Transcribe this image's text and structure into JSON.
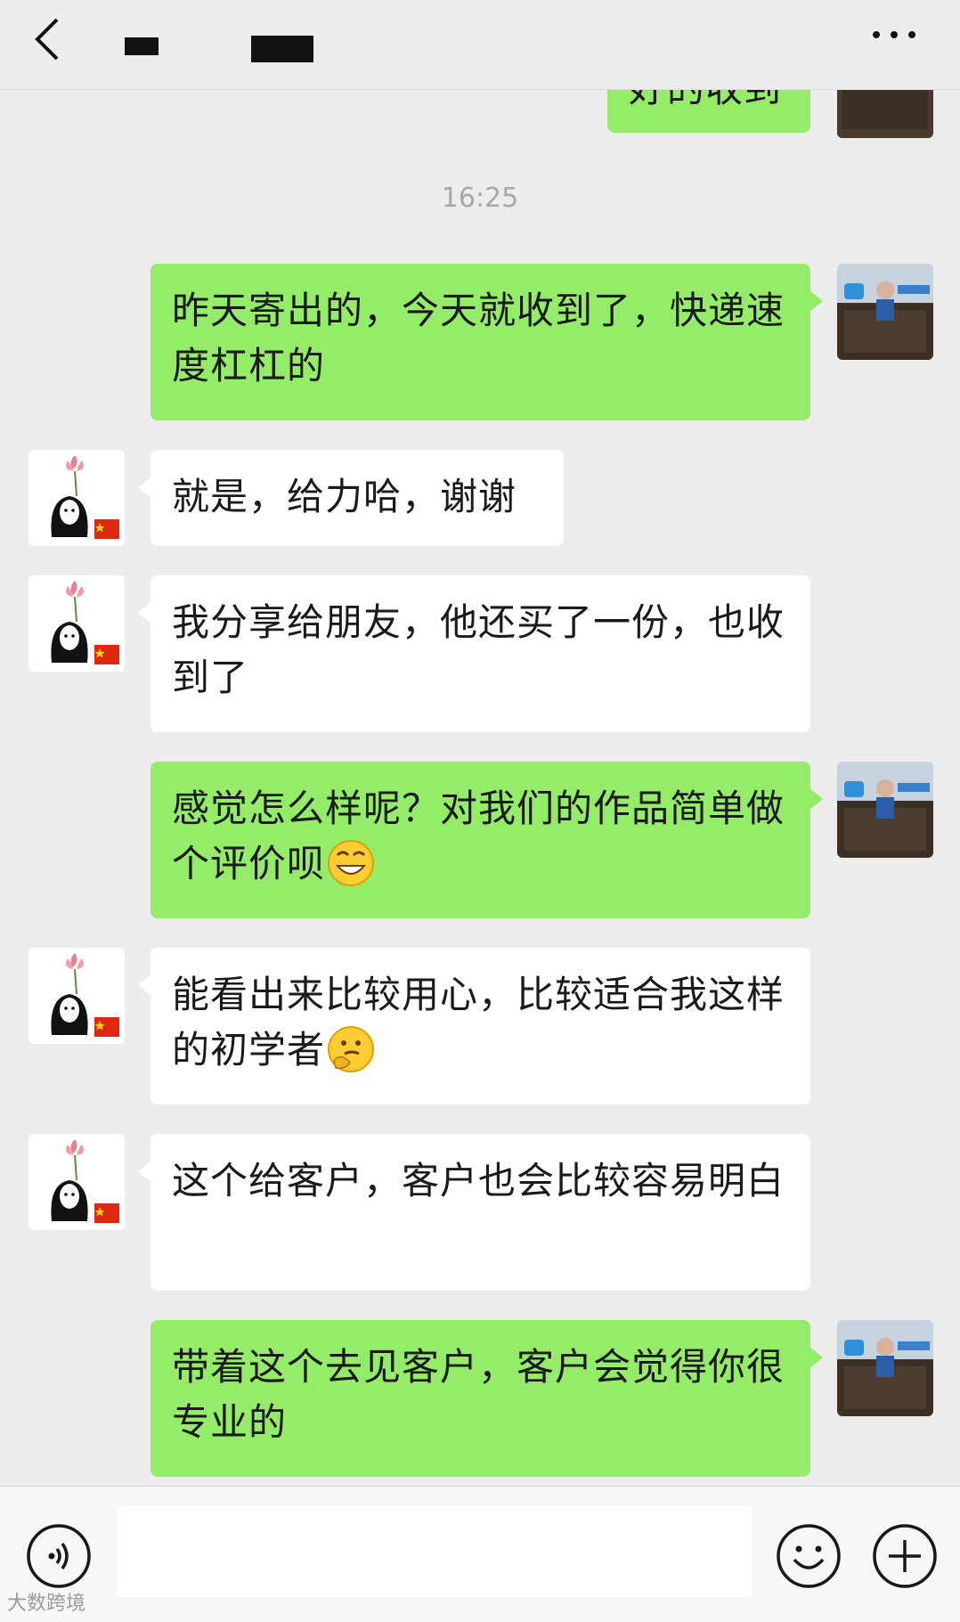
{
  "header": {
    "back_icon": "chevron-left-icon",
    "more_icon": "ellipsis-icon"
  },
  "chat": {
    "partial_top_message": "好的收到",
    "timestamp": "16:25",
    "messages": [
      {
        "side": "sent",
        "text": "昨天寄出的，今天就收到了，快递速度杠杠的"
      },
      {
        "side": "received",
        "text": "就是，给力哈，谢谢"
      },
      {
        "side": "received",
        "text": "我分享给朋友，他还买了一份，也收到了"
      },
      {
        "side": "sent",
        "text": "感觉怎么样呢？对我们的作品简单做个评价呗",
        "emoji": "grinning-face-emoji"
      },
      {
        "side": "received",
        "text": "能看出来比较用心，比较适合我这样的初学者",
        "emoji": "thinking-face-emoji"
      },
      {
        "side": "received",
        "text": "这个给客户，客户也会比较容易明白"
      },
      {
        "side": "sent",
        "text": "带着这个去见客户，客户会觉得你很专业的"
      }
    ]
  },
  "input_bar": {
    "voice_icon": "voice-icon",
    "emoji_icon": "smiley-icon",
    "plus_icon": "plus-icon"
  },
  "watermark": "大数跨境",
  "colors": {
    "sent_bubble": "#95ec69",
    "received_bubble": "#ffffff",
    "background": "#ededed"
  }
}
